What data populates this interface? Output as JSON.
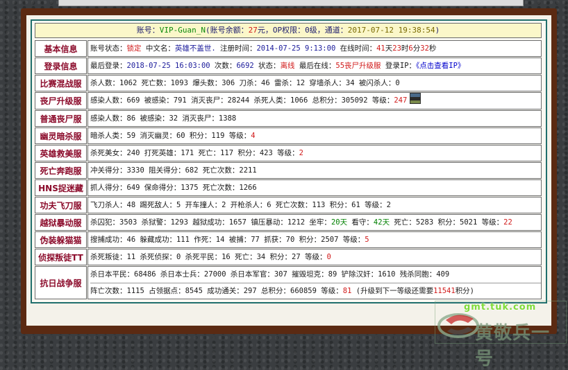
{
  "header": {
    "account_label": "账号：",
    "account": "VIP-Guan_N",
    "balance_label": "(账号余额：",
    "balance": "27",
    "balance_unit": "元，OP权限：",
    "op_level": "0级",
    "channel_label": "，通道：",
    "channel_time": "2017-07-12 19:38:54",
    "close": ")"
  },
  "rows": [
    {
      "label": "基本信息"
    },
    {
      "label": "登录信息"
    },
    {
      "label": "比赛混战服"
    },
    {
      "label": "丧尸升级服"
    },
    {
      "label": "普通丧尸服"
    },
    {
      "label": "幽灵暗杀服"
    },
    {
      "label": "英雄救美服"
    },
    {
      "label": "死亡奔跑服"
    },
    {
      "label": "HNS捉迷藏"
    },
    {
      "label": "功夫飞刀服"
    },
    {
      "label": "越狱暴动服"
    },
    {
      "label": "伪装躲猫猫"
    },
    {
      "label": "侦探叛徒TT"
    },
    {
      "label": "抗日战争服"
    }
  ],
  "basic": {
    "status_label": "账号状态：",
    "status": "锁定",
    "cn_name_label": " 中文名：",
    "cn_name": "英雄不盖世.",
    "reg_label": " 注册时间：",
    "reg_time": "2014-07-25 9:13:00",
    "online_label": " 在线时间：",
    "days": "41",
    "days_u": "天",
    "hours": "23",
    "hours_u": "时",
    "mins": "6",
    "mins_u": "分",
    "secs": "32",
    "secs_u": "秒"
  },
  "login": {
    "last_label": "最后登录：",
    "last": "2018-07-25 16:03:00",
    "count_label": " 次数：",
    "count": "6692",
    "state_label": " 状态：",
    "state": "离线",
    "last_online_label": " 最后在线：",
    "last_online": "55丧尸升级服",
    "ip_label": " 登录IP：",
    "ip_link": "《点击查看IP》"
  },
  "match": "杀人数：1062 死亡数：1093 爆头数：306 刀杀：46 雷杀：12 穿墙杀人：34 被闪杀人：0",
  "zombie_up": {
    "text": "感染人数：669 被感染：791 消灭丧尸：28244 杀死人类：1066 总积分：305092 等级：",
    "level": "247"
  },
  "zombie": "感染人数：86 被感染：32 消灭丧尸：1388",
  "ghost": {
    "text": "暗杀人类：59 消灭幽灵：60 积分：119 等级：",
    "level": "4"
  },
  "hero": {
    "text": "杀死美女：240 打死英雄：171 死亡：117 积分：423 等级：",
    "level": "2"
  },
  "deathrun": "冲关得分：3330 阻关得分：682 死亡次数：2211",
  "hns": "抓人得分：649 保命得分：1375 死亡次数：1266",
  "kungfu": "飞刀杀人：48 踢死敌人：5 开车撞人：2 开枪杀人：6 死亡次数：113 积分：61 等级：2",
  "jail": {
    "p1": "杀囚犯：3503 杀狱警：1293 越狱成功：1657 镇压暴动：1212 坐牢：",
    "jail_days": "20天",
    "p2": " 看守：",
    "guard_days": "42天",
    "p3": " 死亡：5283 积分：5021 等级：",
    "level": "22"
  },
  "prophunt": {
    "text": "搜捕成功：46 躲藏成功：111 作死：14 被捕：77 抓获：70 积分：2507 等级：",
    "level": "5"
  },
  "ttt": {
    "text": "杀死叛徒：11 杀死侦探：0 杀死平民：16 死亡：34 积分：27 等级：",
    "level": "0"
  },
  "war": {
    "line1": "杀日本平民：68486 杀日本士兵：27000 杀日本军官：307 摧毁坦克：89 铲除汉奸：1610 残杀同胞：409",
    "line2_a": "阵亡次数：1115 占领据点：8545 成功通关：297 总积分：660859 等级：",
    "level": "81",
    "line2_b": " (升级到下一等级还需要",
    "need": "11541",
    "line2_c": "积分)"
  },
  "watermark": {
    "line1": "gmt.tuk.com",
    "line2": "黄敬兵一号"
  }
}
